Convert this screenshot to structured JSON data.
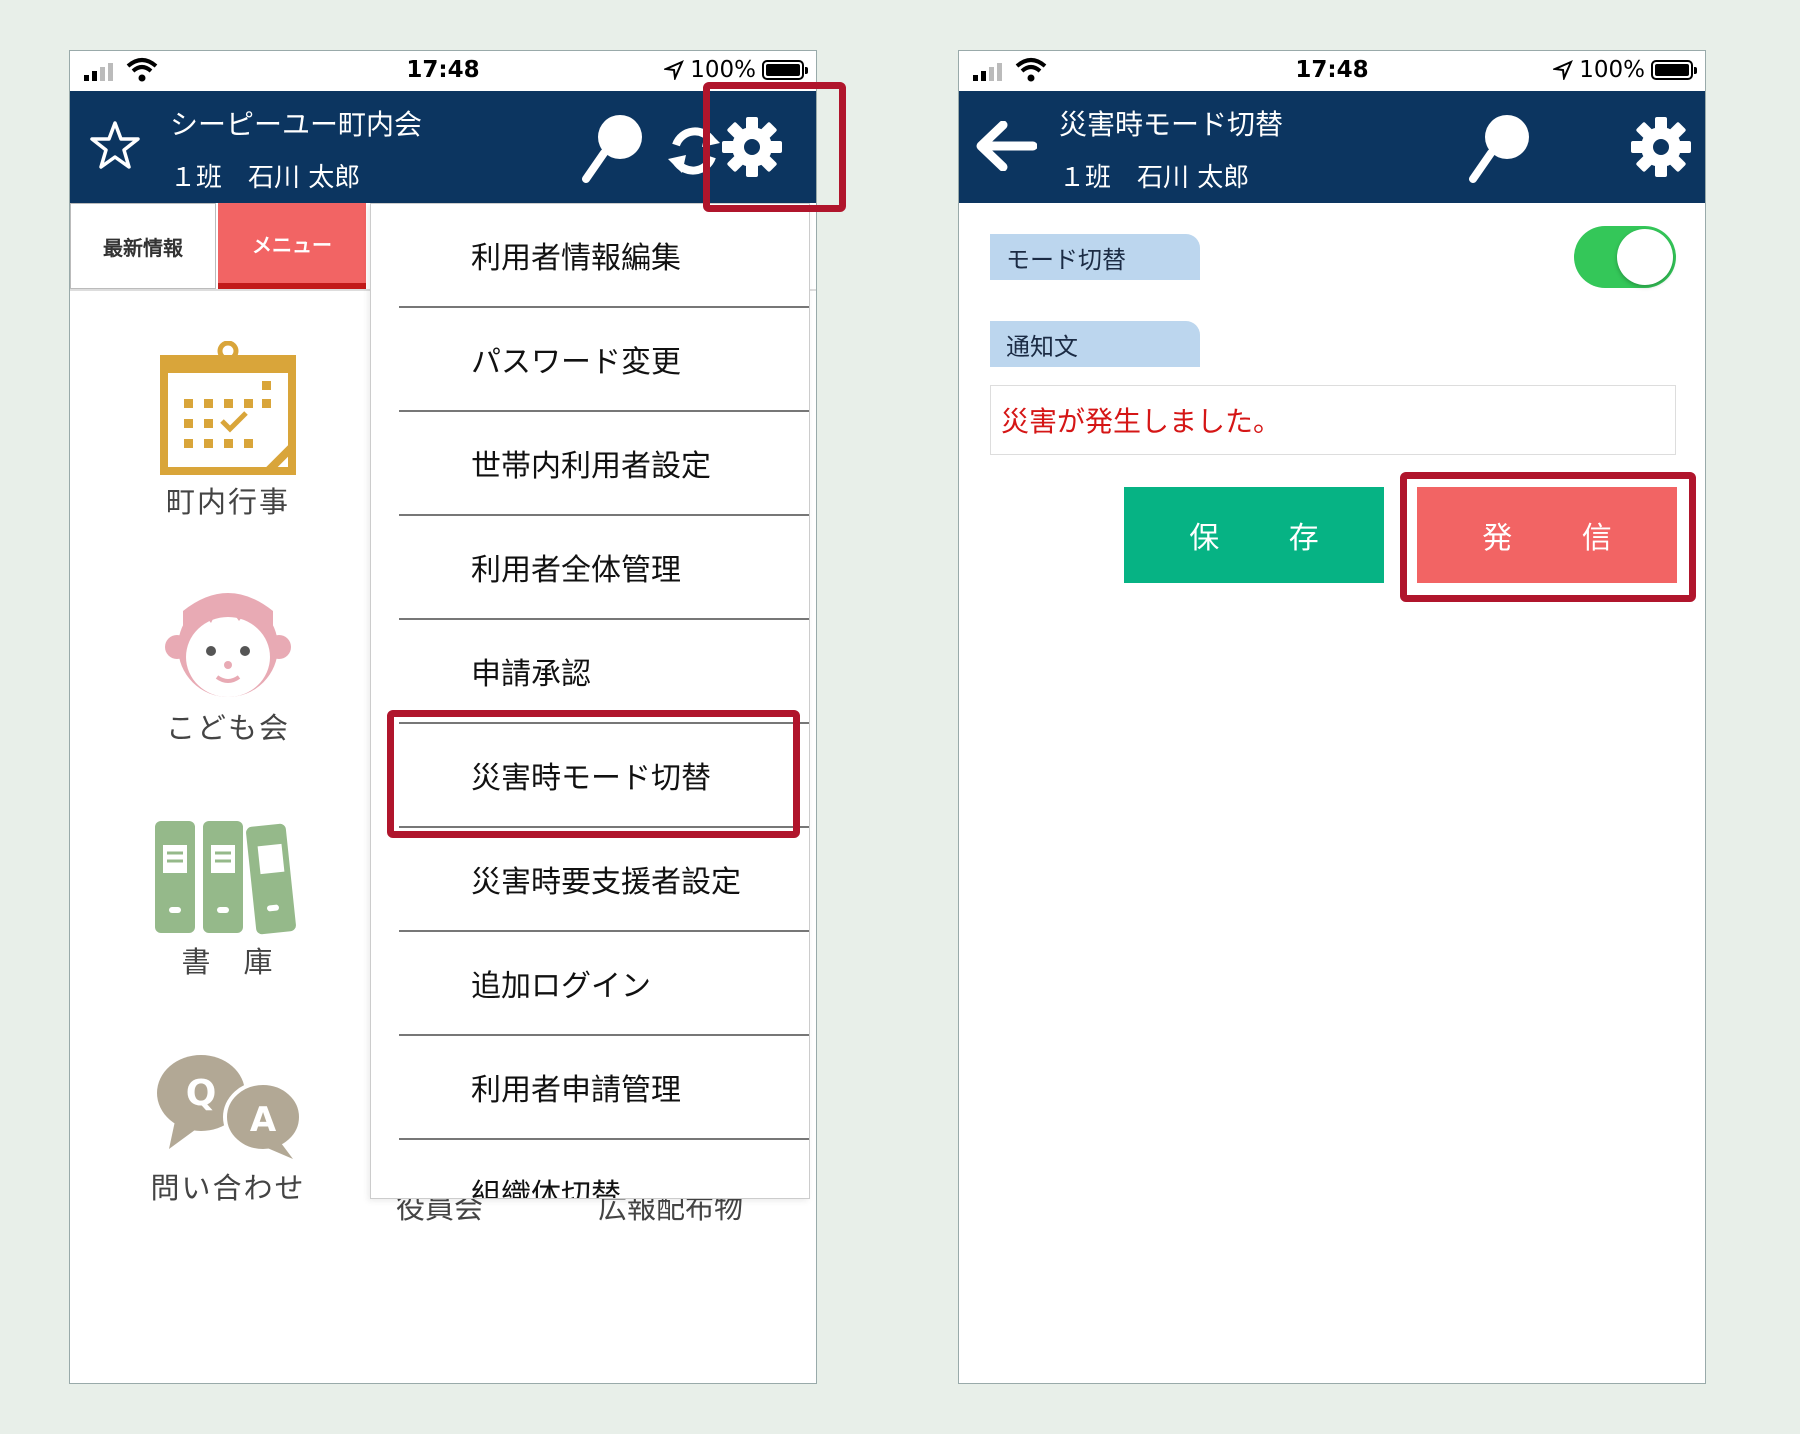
{
  "status_bar": {
    "time": "17:48",
    "battery_percent": "100%"
  },
  "left_screen": {
    "header": {
      "title": "シーピーユー町内会",
      "subtitle": "１班　石川 太郎"
    },
    "tabs": [
      {
        "label": "最新情報"
      },
      {
        "label": "メニュー"
      }
    ],
    "grid": [
      {
        "label": "町内行事",
        "icon": "calendar-icon"
      },
      {
        "label": "こども会",
        "icon": "child-icon"
      },
      {
        "label": "書　庫",
        "icon": "binders-icon"
      },
      {
        "label": "問い合わせ",
        "icon": "qa-bubbles-icon"
      }
    ],
    "partial_labels": {
      "board": "役員会",
      "pr": "広報配布物"
    },
    "menu": [
      {
        "label": "利用者情報編集"
      },
      {
        "label": "パスワード変更"
      },
      {
        "label": "世帯内利用者設定"
      },
      {
        "label": "利用者全体管理"
      },
      {
        "label": "申請承認"
      },
      {
        "label": "災害時モード切替"
      },
      {
        "label": "災害時要支援者設定"
      },
      {
        "label": "追加ログイン"
      },
      {
        "label": "利用者申請管理"
      },
      {
        "label": "組織体切替"
      }
    ]
  },
  "right_screen": {
    "header": {
      "title": "災害時モード切替",
      "subtitle": "１班　石川 太郎"
    },
    "mode_label": "モード切替",
    "mode_enabled": true,
    "notice_label": "通知文",
    "notice_text": "災害が発生しました。",
    "save_label": "保 存",
    "send_label": "発 信"
  },
  "colors": {
    "header_bg": "#0c3560",
    "menu_tab": "#f26464",
    "save_button": "#06b384",
    "send_button": "#f26464",
    "highlight": "#b0152c",
    "toggle_on": "#34c759"
  }
}
